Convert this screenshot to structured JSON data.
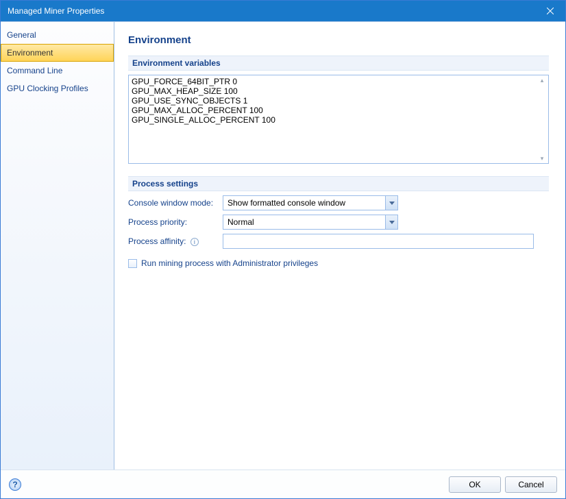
{
  "window": {
    "title": "Managed Miner Properties"
  },
  "sidebar": {
    "items": [
      {
        "label": "General"
      },
      {
        "label": "Environment"
      },
      {
        "label": "Command Line"
      },
      {
        "label": "GPU Clocking Profiles"
      }
    ],
    "selected_index": 1
  },
  "page": {
    "heading": "Environment",
    "env_vars_group": "Environment variables",
    "env_vars_value": "GPU_FORCE_64BIT_PTR 0\nGPU_MAX_HEAP_SIZE 100\nGPU_USE_SYNC_OBJECTS 1\nGPU_MAX_ALLOC_PERCENT 100\nGPU_SINGLE_ALLOC_PERCENT 100",
    "process_group": "Process settings",
    "console_mode_label": "Console window mode:",
    "console_mode_value": "Show formatted console window",
    "priority_label": "Process priority:",
    "priority_value": "Normal",
    "affinity_label": "Process affinity:",
    "affinity_value": "",
    "admin_checkbox_label": "Run mining process with Administrator privileges",
    "admin_checkbox_checked": false
  },
  "footer": {
    "help": "?",
    "ok": "OK",
    "cancel": "Cancel"
  }
}
